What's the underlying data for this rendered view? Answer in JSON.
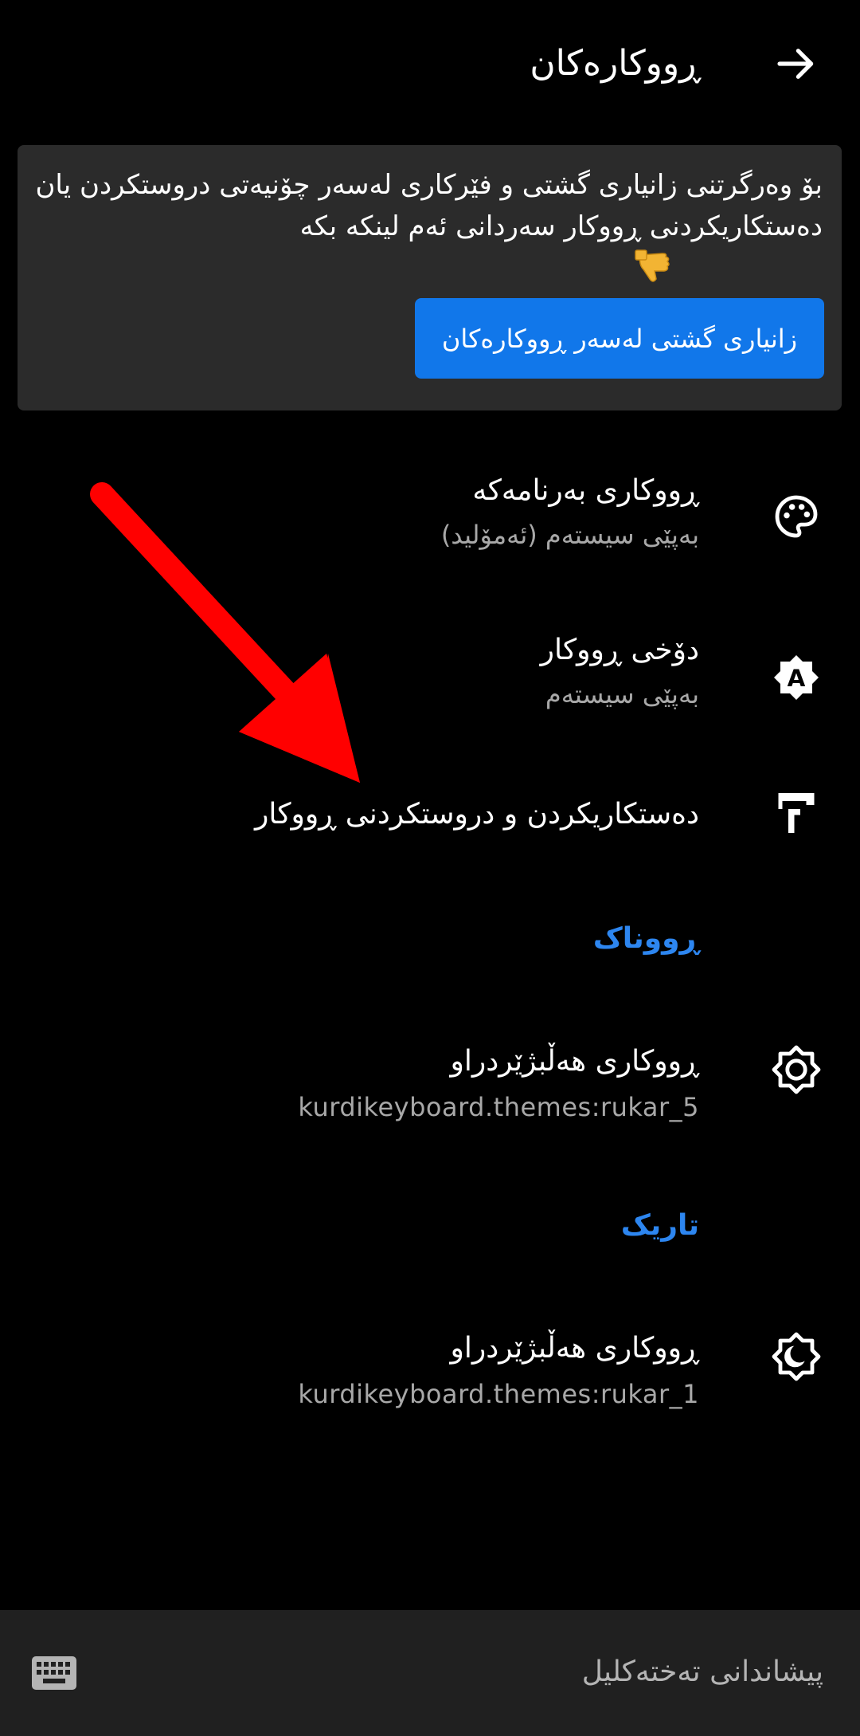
{
  "header": {
    "title": "ڕووکارەکان",
    "back_icon": "arrow-right-icon"
  },
  "info_card": {
    "text": "بۆ وەرگرتنی زانیاری گشتی و فێرکاری لەسەر چۆنیەتی دروستکردن یان دەستکاریکردنی ڕووکار سەردانی ئەم لینکە بکە",
    "emoji": "pointing-down-hand-emoji",
    "button_label": "زانیاری گشتی لەسەر ڕووکارەکان"
  },
  "preferences": [
    {
      "icon": "palette-icon",
      "title": "ڕووکاری بەرنامەکە",
      "summary": "بەپێی سیستەم (ئەمۆلید)"
    },
    {
      "icon": "auto-brightness-icon",
      "title": "دۆخی ڕووکار",
      "summary": "بەپێی سیستەم"
    },
    {
      "icon": "paint-roller-icon",
      "title": "دەستکاریکردن و دروستکردنی ڕووکار"
    }
  ],
  "categories": {
    "light": "ڕووناک",
    "dark": "تاریک"
  },
  "light_theme": {
    "icon": "sun-icon",
    "title": "ڕووکاری هەڵبژێردراو",
    "summary": "kurdikeyboard.themes:rukar_5"
  },
  "dark_theme": {
    "icon": "moon-icon",
    "title": "ڕووکاری هەڵبژێردراو",
    "summary": "kurdikeyboard.themes:rukar_1"
  },
  "bottom_bar": {
    "label": "پیشاندانی تەختەکلیل",
    "icon": "keyboard-icon"
  },
  "annotation": {
    "icon": "red-arrow-icon",
    "color": "#ff0000"
  },
  "colors": {
    "accent": "#2d86f0",
    "button": "#1177ea",
    "card": "#2b2b2b",
    "bottom_bar": "#202020"
  }
}
